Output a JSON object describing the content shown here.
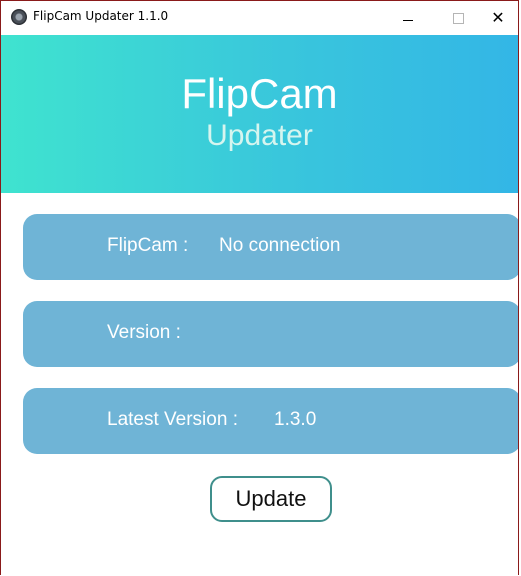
{
  "window": {
    "title": "FlipCam Updater 1.1.0",
    "controls": {
      "minimize": "–",
      "maximize": "□",
      "close": "✕"
    }
  },
  "header": {
    "title": "FlipCam",
    "subtitle": "Updater"
  },
  "cards": [
    {
      "label": "FlipCam :",
      "value": "No connection"
    },
    {
      "label": "Version :",
      "value": ""
    },
    {
      "label": "Latest Version :",
      "value": "1.3.0"
    }
  ],
  "actions": {
    "update_label": "Update"
  },
  "colors": {
    "header_gradient_start": "#3fe3cf",
    "header_gradient_end": "#33b6e6",
    "card_background": "#6fb4d6",
    "button_border": "#3f8f8c"
  },
  "icons": {
    "app": "flipcam-app-icon",
    "minimize": "minimize-icon",
    "maximize": "maximize-icon",
    "close": "close-icon"
  }
}
